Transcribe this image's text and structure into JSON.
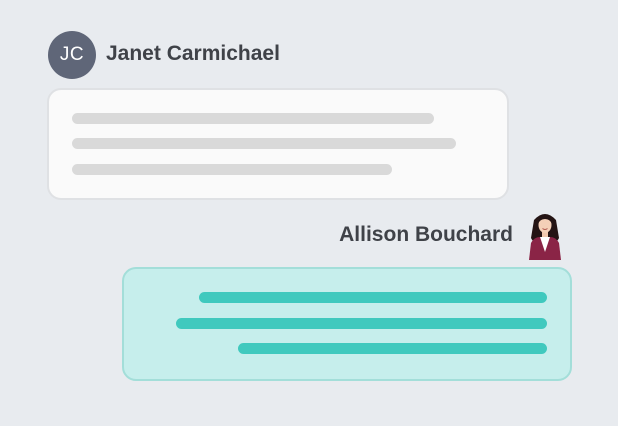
{
  "conversation": {
    "incoming": {
      "sender": {
        "name": "Janet Carmichael",
        "initials": "JC"
      },
      "message": {
        "content": "redacted text lines",
        "line_count": 3
      }
    },
    "outgoing": {
      "sender": {
        "name": "Allison Bouchard",
        "avatar": "profile-photo"
      },
      "message": {
        "content": "redacted text lines",
        "line_count": 3
      }
    }
  },
  "colors": {
    "page_background": "#e8ebef",
    "initials_avatar": "#5f6678",
    "incoming_bubble": "#fafafa",
    "incoming_lines": "#d9d9d9",
    "outgoing_bubble": "#c6eeec",
    "outgoing_border": "#a3ded9",
    "outgoing_lines": "#40c9be"
  }
}
